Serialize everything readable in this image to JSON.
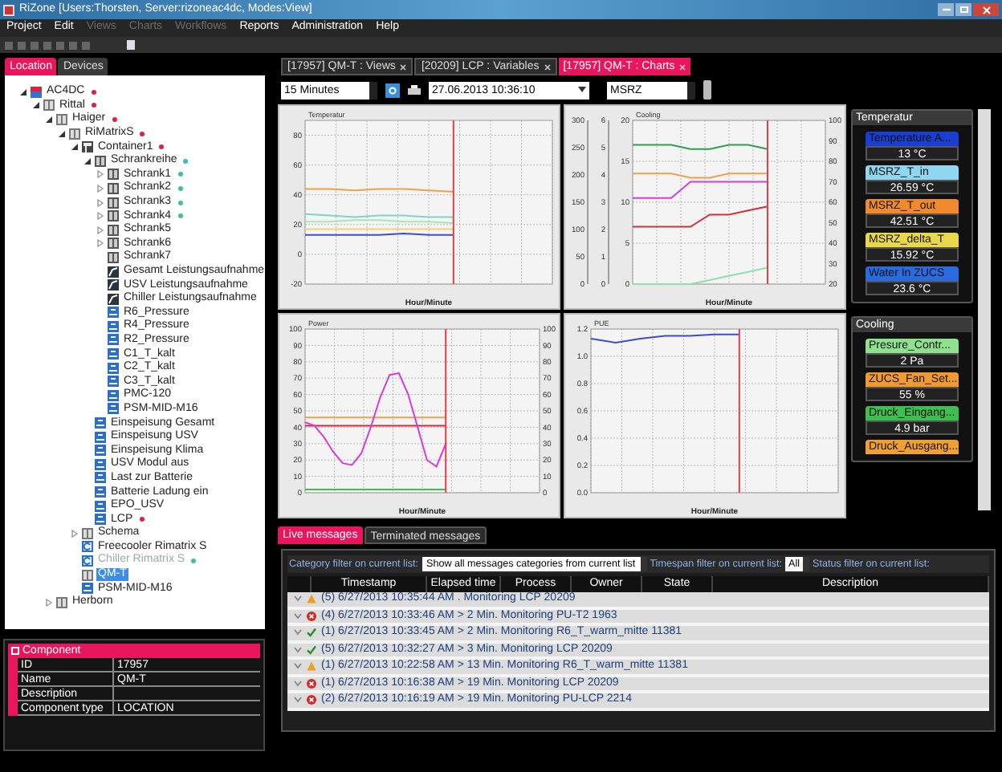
{
  "window": {
    "title": "RiZone [Users:Thorsten, Server:rizoneac4dc, Modes:View]"
  },
  "menu": [
    {
      "label": "Project",
      "disabled": false
    },
    {
      "label": "Edit",
      "disabled": false
    },
    {
      "label": "Views",
      "disabled": true
    },
    {
      "label": "Charts",
      "disabled": true
    },
    {
      "label": "Workflows",
      "disabled": true
    },
    {
      "label": "Reports",
      "disabled": false
    },
    {
      "label": "Administration",
      "disabled": false
    },
    {
      "label": "Help",
      "disabled": false
    }
  ],
  "left_tabs": [
    {
      "label": "Location",
      "selected": true
    },
    {
      "label": "Devices",
      "selected": false
    }
  ],
  "tree": [
    {
      "label": "AC4DC",
      "kind": "site",
      "color": "#d8253f",
      "selected": false,
      "disabled": false,
      "expanded": true,
      "children": [
        {
          "label": "Rittal",
          "kind": "location",
          "color": "#d8253f",
          "selected": false,
          "disabled": false,
          "expanded": true,
          "children": [
            {
              "label": "Haiger",
              "kind": "location",
              "color": "#d8253f",
              "selected": false,
              "disabled": false,
              "expanded": true,
              "children": [
                {
                  "label": "RiMatrixS",
                  "kind": "location",
                  "color": "#d8253f",
                  "selected": false,
                  "disabled": false,
                  "expanded": true,
                  "children": [
                    {
                      "label": "Container1",
                      "kind": "room",
                      "color": "#d8253f",
                      "selected": false,
                      "disabled": false,
                      "expanded": true,
                      "children": [
                        {
                          "label": "Schrankreihe",
                          "kind": "cabinet",
                          "color": "#3fbf9f",
                          "selected": false,
                          "disabled": false,
                          "expanded": true,
                          "children": [
                            {
                              "label": "Schrank1",
                              "kind": "cabinet",
                              "color": "#3fbf9f",
                              "selected": false,
                              "disabled": false,
                              "expanded": false
                            },
                            {
                              "label": "Schrank2",
                              "kind": "cabinet",
                              "color": "#3fbf9f",
                              "selected": false,
                              "disabled": false,
                              "expanded": false
                            },
                            {
                              "label": "Schrank3",
                              "kind": "cabinet",
                              "color": "#3fbf9f",
                              "selected": false,
                              "disabled": false,
                              "expanded": false
                            },
                            {
                              "label": "Schrank4",
                              "kind": "cabinet",
                              "color": "#3fbf9f",
                              "selected": false,
                              "disabled": false,
                              "expanded": false
                            },
                            {
                              "label": "Schrank5",
                              "kind": "cabinet",
                              "selected": false,
                              "disabled": false,
                              "expanded": false
                            },
                            {
                              "label": "Schrank6",
                              "kind": "cabinet",
                              "selected": false,
                              "disabled": false,
                              "expanded": false
                            },
                            {
                              "label": "Schrank7",
                              "kind": "cabinet",
                              "selected": false,
                              "disabled": false
                            },
                            {
                              "label": "Gesamt Leistungsaufnahme",
                              "kind": "meter",
                              "selected": false,
                              "disabled": false
                            },
                            {
                              "label": "USV Leistungsaufnahme",
                              "kind": "meter",
                              "selected": false,
                              "disabled": false
                            },
                            {
                              "label": "Chiller Leistungsaufnahme",
                              "kind": "meter",
                              "selected": false,
                              "disabled": false
                            },
                            {
                              "label": "R6_Pressure",
                              "kind": "sensor",
                              "selected": false,
                              "disabled": false
                            },
                            {
                              "label": "R4_Pressure",
                              "kind": "sensor",
                              "selected": false,
                              "disabled": false
                            },
                            {
                              "label": "R2_Pressure",
                              "kind": "sensor",
                              "selected": false,
                              "disabled": false
                            },
                            {
                              "label": "C1_T_kalt",
                              "kind": "sensor",
                              "selected": false,
                              "disabled": false
                            },
                            {
                              "label": "C2_T_kalt",
                              "kind": "sensor",
                              "selected": false,
                              "disabled": false
                            },
                            {
                              "label": "C3_T_kalt",
                              "kind": "sensor",
                              "selected": false,
                              "disabled": false
                            },
                            {
                              "label": "PMC-120",
                              "kind": "sensor",
                              "selected": false,
                              "disabled": false
                            },
                            {
                              "label": "PSM-MID-M16",
                              "kind": "sensor",
                              "selected": false,
                              "disabled": false
                            }
                          ]
                        },
                        {
                          "label": "Einspeisung Gesamt",
                          "kind": "sensor",
                          "selected": false,
                          "disabled": false
                        },
                        {
                          "label": "Einspeisung USV",
                          "kind": "sensor",
                          "selected": false,
                          "disabled": false
                        },
                        {
                          "label": "Einspeisung Klima",
                          "kind": "sensor",
                          "selected": false,
                          "disabled": false
                        },
                        {
                          "label": "USV Modul aus",
                          "kind": "sensor",
                          "selected": false,
                          "disabled": false
                        },
                        {
                          "label": "Last zur Batterie",
                          "kind": "sensor",
                          "selected": false,
                          "disabled": false
                        },
                        {
                          "label": "Batterie Ladung ein",
                          "kind": "sensor",
                          "selected": false,
                          "disabled": false
                        },
                        {
                          "label": "EPO_USV",
                          "kind": "sensor",
                          "selected": false,
                          "disabled": false
                        },
                        {
                          "label": "LCP",
                          "kind": "sensor",
                          "color": "#d8253f",
                          "selected": false,
                          "disabled": false
                        }
                      ]
                    },
                    {
                      "label": "Schema",
                      "kind": "location",
                      "selected": false,
                      "disabled": false,
                      "expanded": false
                    },
                    {
                      "label": "Freecooler Rimatrix S",
                      "kind": "component",
                      "selected": false,
                      "disabled": false
                    },
                    {
                      "label": "Chiller Rimatrix S",
                      "kind": "component",
                      "color": "#3fbf9f",
                      "selected": false,
                      "disabled": true
                    },
                    {
                      "label": "QM-T",
                      "kind": "location",
                      "selected": true,
                      "disabled": false
                    },
                    {
                      "label": "PSM-MID-M16",
                      "kind": "sensor",
                      "selected": false,
                      "disabled": false
                    }
                  ]
                }
              ]
            },
            {
              "label": "Herborn",
              "kind": "location",
              "selected": false,
              "disabled": false,
              "expanded": false
            }
          ]
        }
      ]
    }
  ],
  "properties": {
    "title": "Component",
    "rows": [
      {
        "key": "ID",
        "value": "17957"
      },
      {
        "key": "Name",
        "value": "QM-T"
      },
      {
        "key": "Description"
      },
      {
        "key": "Component type",
        "value": "LOCATION"
      }
    ]
  },
  "doc_tabs": [
    {
      "label": "[17957] QM-T : Views",
      "selected": false
    },
    {
      "label": "[20209] LCP : Variables",
      "selected": false
    },
    {
      "label": "[17957] QM-T : Charts",
      "selected": true
    }
  ],
  "toolbar": {
    "interval": "15 Minutes",
    "datetime": "27.06.2013 10:36:10",
    "group": "MSRZ"
  },
  "charts": [
    {
      "chart_data": {
        "type": "line",
        "title": "Temperatur",
        "grid": true,
        "xlabel": "Hour/Minute",
        "categories": [
          null,
          null,
          null,
          null,
          null,
          null,
          null,
          null,
          null,
          null,
          null
        ],
        "ylim": [
          -20,
          90
        ],
        "yticks": [
          -20,
          0,
          20,
          40,
          60,
          80
        ],
        "series": [
          {
            "color": "#f0a04a",
            "values": [
              44,
              44,
              43,
              44,
              44,
              43,
              42,
              null,
              null,
              null,
              null
            ]
          },
          {
            "color": "#7fd3c8",
            "values": [
              27,
              26,
              25,
              26,
              26,
              25,
              25,
              null,
              null,
              null,
              null
            ]
          },
          {
            "color": "#a8e6b0",
            "values": [
              22,
              22,
              23,
              23,
              22,
              22,
              21,
              null,
              null,
              null,
              null
            ]
          },
          {
            "color": "#f2d36b",
            "values": [
              17,
              17,
              17,
              17,
              17,
              17,
              17,
              null,
              null,
              null,
              null
            ]
          },
          {
            "color": "#3b4fc4",
            "values": [
              13,
              13,
              13,
              13,
              14,
              13,
              13,
              null,
              null,
              null,
              null
            ]
          }
        ]
      }
    },
    {
      "chart_data": {
        "type": "line",
        "title": "Cooling",
        "grid": true,
        "xlabel": "Hour/Minute",
        "categories": [
          null,
          null,
          null,
          null,
          null,
          null,
          null,
          null,
          null,
          null,
          null
        ],
        "ylim": [
          0,
          20
        ],
        "yticks": [
          0,
          5,
          10,
          15,
          20
        ],
        "series": [
          {
            "color": "#2e9e4f",
            "values": [
              17,
              17,
              17,
              16.5,
              16.5,
              17,
              17,
              16.5,
              null,
              null,
              null
            ]
          },
          {
            "color": "#f0a04a",
            "values": [
              13.5,
              13.5,
              13.5,
              13,
              13,
              13.5,
              13.5,
              13.5,
              null,
              null,
              null
            ]
          },
          {
            "color": "#d63fd6",
            "values": [
              10.5,
              10.5,
              10.5,
              12.5,
              12.5,
              12.5,
              12.5,
              12.5,
              null,
              null,
              null
            ]
          },
          {
            "color": "#d0303a",
            "values": [
              7,
              7,
              7,
              7,
              8.5,
              8.5,
              9,
              9.5,
              null,
              null,
              null
            ]
          },
          {
            "color": "#8fe0a8",
            "values": [
              0,
              0,
              0,
              0,
              0.5,
              1,
              1.5,
              2,
              null,
              null,
              null
            ]
          }
        ]
      },
      "left_axes": [
        [
          "300",
          "250",
          "200",
          "150",
          "100",
          "50",
          "0"
        ],
        [
          "6",
          "5",
          "4",
          "3",
          "2",
          "1",
          "0"
        ]
      ],
      "right_axis": [
        "100",
        "90",
        "80",
        "70",
        "60",
        "50",
        "40",
        "30",
        "20"
      ]
    },
    {
      "chart_data": {
        "type": "line",
        "title": "Power",
        "grid": true,
        "xlabel": "Hour/Minute",
        "categories": [
          null,
          null,
          null,
          null,
          null,
          null,
          null,
          null,
          null,
          null,
          null,
          null,
          null,
          null,
          null,
          null,
          null,
          null,
          null,
          null,
          null,
          null,
          null,
          null,
          null,
          null
        ],
        "ylim": [
          0,
          100
        ],
        "yticks": [
          0,
          10,
          20,
          30,
          40,
          50,
          60,
          70,
          80,
          90,
          100
        ],
        "series": [
          {
            "color": "#f0a04a",
            "values": [
              46,
              46,
              46,
              46,
              46,
              46,
              46,
              46,
              46,
              46,
              46,
              46,
              46,
              46,
              46,
              46,
              null,
              null,
              null,
              null,
              null,
              null,
              null,
              null,
              null,
              null
            ]
          },
          {
            "color": "#d0303a",
            "values": [
              41,
              41,
              41,
              41,
              41,
              41,
              41,
              41,
              41,
              41,
              41,
              41,
              41,
              41,
              41,
              41,
              null,
              null,
              null,
              null,
              null,
              null,
              null,
              null,
              null,
              null
            ]
          },
          {
            "color": "#d63fd6",
            "values": [
              43,
              41,
              34,
              25,
              18,
              17,
              24,
              40,
              58,
              72,
              73,
              60,
              40,
              20,
              16,
              30,
              null,
              null,
              null,
              null,
              null,
              null,
              null,
              null,
              null,
              null
            ]
          },
          {
            "color": "#3fbf4f",
            "values": [
              2,
              2,
              2,
              2,
              2,
              2,
              2,
              2,
              2,
              2,
              2,
              2,
              2,
              2,
              2,
              2,
              null,
              null,
              null,
              null,
              null,
              null,
              null,
              null,
              null,
              null
            ]
          }
        ]
      },
      "right_axis": [
        "100",
        "90",
        "80",
        "70",
        "60",
        "50",
        "40",
        "30",
        "20",
        "10",
        "0"
      ]
    },
    {
      "chart_data": {
        "type": "line",
        "title": "PUE",
        "grid": true,
        "xlabel": "Hour/Minute",
        "categories": [
          null,
          null,
          null,
          null,
          null,
          null,
          null,
          null,
          null,
          null,
          null
        ],
        "ylim": [
          0,
          1.2
        ],
        "yticks": [
          {
            "value": 0,
            "label": "0.0"
          },
          {
            "value": 0.2,
            "label": "0.2"
          },
          {
            "value": 0.4,
            "label": "0.4"
          },
          {
            "value": 0.6,
            "label": "0.6"
          },
          {
            "value": 0.8,
            "label": "0.8"
          },
          {
            "value": 1,
            "label": "1.0"
          },
          {
            "value": 1.2,
            "label": "1.2"
          }
        ],
        "series": [
          {
            "color": "#3b4fc4",
            "values": [
              1.13,
              1.1,
              1.13,
              1.15,
              1.15,
              1.16,
              1.16,
              null,
              null,
              null,
              null
            ]
          }
        ]
      }
    }
  ],
  "side_panels": [
    {
      "title": "Temperatur",
      "tiles": [
        {
          "label": "Temperature A...",
          "value": "13 °C",
          "color": "#1a3fd0"
        },
        {
          "label": "MSRZ_T_in",
          "value": "26.59 °C",
          "color": "#8fd7f0"
        },
        {
          "label": "MSRZ_T_out",
          "value": "42.51 °C",
          "color": "#f08a2c"
        },
        {
          "label": "MSRZ_delta_T",
          "value": "15.92 °C",
          "color": "#e8d84a"
        },
        {
          "label": "Water In ZUCS",
          "value": "23.6 °C",
          "color": "#2a6be0"
        }
      ]
    },
    {
      "title": "Cooling",
      "tiles": [
        {
          "label": "Presure_Contr...",
          "value": "2 Pa",
          "color": "#8fe08f"
        },
        {
          "label": "ZUCS_Fan_Set...",
          "value": "55 %",
          "color": "#f09a30"
        },
        {
          "label": "Druck_Eingang...",
          "value": "4.9 bar",
          "color": "#3fbf4f"
        },
        {
          "label": "Druck_Ausgang...",
          "color": "#f0a030"
        }
      ]
    }
  ],
  "messages": {
    "tabs": [
      {
        "label": "Live messages",
        "selected": true
      },
      {
        "label": "Terminated messages",
        "selected": false
      }
    ],
    "category_label": "Category filter on current list:",
    "category_value": "Show all messages categories from current list",
    "timespan_label": "Timespan filter on current list:",
    "timespan_value": "All",
    "status_label": "Status filter on current list:",
    "columns": [
      "Timestamp",
      "Elapsed time",
      "Process",
      "Owner",
      "State",
      "Description"
    ],
    "rows": [
      {
        "kind": "warning",
        "text": "(5) 6/27/2013 10:35:44 AM . Monitoring LCP 20209"
      },
      {
        "kind": "error",
        "text": "(4) 6/27/2013 10:33:46 AM > 2 Min. Monitoring PU-T2 1963"
      },
      {
        "kind": "ok",
        "text": "(1) 6/27/2013 10:33:45 AM > 2 Min. Monitoring R6_T_warm_mitte 11381"
      },
      {
        "kind": "ok",
        "text": "(5) 6/27/2013 10:32:27 AM > 3 Min. Monitoring LCP 20209"
      },
      {
        "kind": "warning",
        "text": "(1) 6/27/2013 10:22:58 AM > 13 Min. Monitoring R6_T_warm_mitte 11381"
      },
      {
        "kind": "error",
        "text": "(1) 6/27/2013 10:16:38 AM > 19 Min. Monitoring LCP 20209"
      },
      {
        "kind": "error",
        "text": "(2) 6/27/2013 10:16:19 AM > 19 Min. Monitoring PU-LCP 2214"
      }
    ]
  }
}
